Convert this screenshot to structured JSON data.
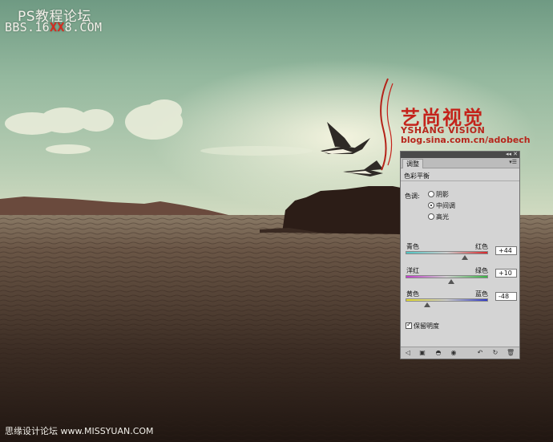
{
  "watermark": {
    "line1": "PS教程论坛",
    "line2_prefix": "BBS.16",
    "line2_highlight": "XX",
    "line2_suffix": "8.COM",
    "brand_cn": "艺尚视觉",
    "brand_en": "YSHANG VISION",
    "brand_url": "blog.sina.com.cn/adobech",
    "footer": "思缘设计论坛 www.MISSYUAN.COM"
  },
  "panel": {
    "tab_label": "调整",
    "heading": "色彩平衡",
    "tone_label": "色调:",
    "tone_options": [
      "阴影",
      "中间调",
      "高光"
    ],
    "tone_selected": 1,
    "sliders": [
      {
        "left": "青色",
        "right": "红色",
        "value": "+44",
        "level": 44
      },
      {
        "left": "洋红",
        "right": "绿色",
        "value": "+10",
        "level": 10
      },
      {
        "left": "黄色",
        "right": "蓝色",
        "value": "-48",
        "level": -48
      }
    ],
    "preserve_label": "保留明度",
    "preserve_checked": true,
    "icons": [
      "back-arrow-icon",
      "layer-mask-icon",
      "visibility-icon",
      "eye-icon",
      "reset-previous-icon",
      "reset-icon",
      "delete-icon"
    ]
  },
  "colors": {
    "brand_red": "#c4231b",
    "panel_bg": "#d4d4d4"
  }
}
